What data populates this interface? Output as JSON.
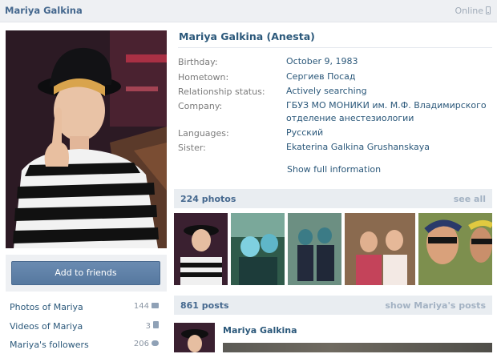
{
  "header": {
    "name": "Mariya Galkina",
    "status": "Online"
  },
  "profile": {
    "full_name": "Mariya Galkina (Anesta)",
    "info": [
      {
        "label": "Birthday:",
        "value": "October 9, 1983"
      },
      {
        "label": "Hometown:",
        "value": "Сергиев Посад"
      },
      {
        "label": "Relationship status:",
        "value": "Actively searching"
      },
      {
        "label": "Company:",
        "value": "ГБУЗ МО МОНИКИ им. М.Ф. Владимирского отделение анестезиологии"
      },
      {
        "label": "Languages:",
        "value": "Русский"
      },
      {
        "label": "Sister:",
        "value": "Ekaterina Galkina Grushanskaya"
      }
    ],
    "show_full": "Show full information"
  },
  "sidebar": {
    "add_friends": "Add to friends",
    "links": [
      {
        "label": "Photos of Mariya",
        "count": "144",
        "icon": "camera-icon"
      },
      {
        "label": "Videos of Mariya",
        "count": "3",
        "icon": "film-icon"
      },
      {
        "label": "Mariya's followers",
        "count": "206",
        "icon": "people-icon"
      }
    ]
  },
  "photos": {
    "title": "224 photos",
    "see_all": "see all"
  },
  "wall": {
    "title": "861 posts",
    "show_link": "show Mariya's posts",
    "author": "Mariya Galkina"
  },
  "colors": {
    "link": "#2b587a",
    "header_link": "#45688e",
    "section_bg": "#e9edf1",
    "button": "#5d7fa6"
  }
}
